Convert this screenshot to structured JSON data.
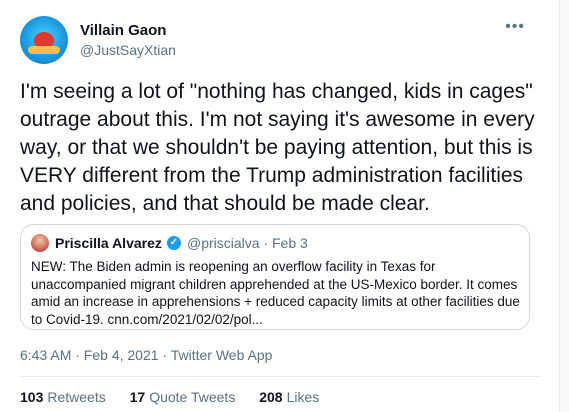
{
  "author": {
    "name": "Villain Gaon",
    "handle": "@JustSayXtian"
  },
  "more_icon": "more-horizontal-icon",
  "tweet": {
    "text": "I'm seeing a lot of \"nothing has changed, kids in cages\" outrage about this. I'm not saying it's awesome in every way, or that we shouldn't be paying attention, but this is VERY different from the Trump administration facilities and policies, and that should be made clear."
  },
  "quoted_tweet": {
    "author_name": "Priscilla Alvarez",
    "verified_icon": "verified-badge-icon",
    "handle_date": "@priscialva · Feb 3",
    "text": "NEW: The Biden admin is reopening an overflow facility in Texas for unaccompanied migrant children apprehended at the US-Mexico border. It comes amid an increase in apprehensions + reduced capacity limits at other facilities due to Covid-19. cnn.com/2021/02/02/pol..."
  },
  "meta": {
    "timestamp_source": "6:43 AM · Feb 4, 2021 · Twitter Web App"
  },
  "stats": {
    "retweets_count": "103",
    "retweets_label": "Retweets",
    "quote_tweets_count": "17",
    "quote_tweets_label": "Quote Tweets",
    "likes_count": "208",
    "likes_label": "Likes"
  },
  "colors": {
    "text_primary": "#0f1419",
    "text_secondary": "#5b7083",
    "verified_blue": "#1d9bf0",
    "border": "#cfd9de"
  }
}
